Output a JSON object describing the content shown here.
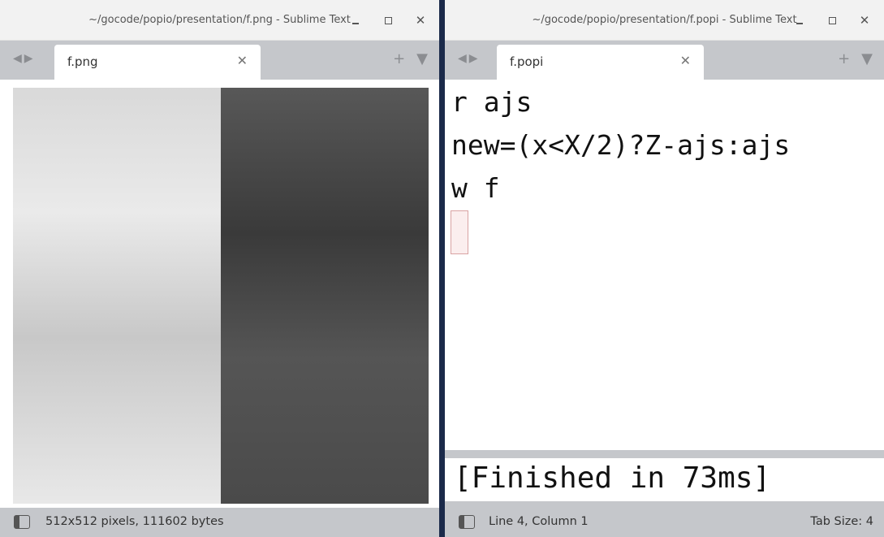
{
  "left_window": {
    "title": "~/gocode/popio/presentation/f.png - Sublime Text",
    "tab_label": "f.png",
    "status_text": "512x512 pixels, 111602 bytes"
  },
  "right_window": {
    "title": "~/gocode/popio/presentation/f.popi - Sublime Text",
    "tab_label": "f.popi",
    "code_lines": [
      "r ajs",
      "new=(x<X/2)?Z-ajs:ajs",
      "w f"
    ],
    "output_text": "[Finished in 73ms]",
    "status_text": "Line 4, Column 1",
    "status_right": "Tab Size: 4"
  },
  "icons": {
    "nav": "left-right-arrows-icon",
    "close": "close-icon",
    "new_tab": "plus-icon",
    "tab_menu": "chevron-down-icon",
    "sidebar": "sidebar-toggle-icon"
  }
}
